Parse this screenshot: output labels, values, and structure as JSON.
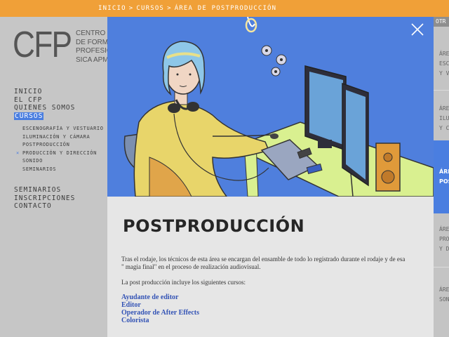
{
  "breadcrumb": {
    "items": [
      "INICIO",
      "CURSOS",
      "ÁREA DE POSTPRODUCCIÓN"
    ],
    "separator": ">"
  },
  "logo": {
    "mark": "CFP",
    "lines": [
      "CENTRO",
      "DE FORMACIÓN",
      "PROFESIONAL",
      "SICA APMA"
    ]
  },
  "menu": {
    "main": [
      "INICIO",
      "EL CFP",
      "QUIENES SOMOS",
      "CURSOS"
    ],
    "active": "CURSOS",
    "sub": [
      "ESCENOGRAFÍA Y VESTUARIO",
      "ILUMINACIÓN Y CÁMARA",
      "POSTPRODUCCIÓN",
      "PRODUCCIÓN Y DIRECCIÓN",
      "SONIDO",
      "SEMINARIOS"
    ],
    "sub_marker": "×",
    "secondary": [
      "SEMINARIOS",
      "INSCRIPCIONES",
      "CONTACTO"
    ]
  },
  "modal": {
    "title": "POSTPRODUCCIÓN",
    "description": "Tras el rodaje, los técnicos de esta área se encargan del ensamble de todo lo registrado durante el rodaje y de esa \" magia final\" en el proceso de realización audiovisual.",
    "intro": "La post producción incluye los siguientes cursos:",
    "courses": [
      "Ayudante de editor",
      "Editor",
      "Operador de After Effects",
      "Colorista"
    ]
  },
  "right_strip": {
    "header": "OTR",
    "items": [
      [
        "ÁRE",
        "ESC",
        "Y V"
      ],
      [
        "ÁRE",
        "ILU",
        "Y C"
      ],
      [
        "ÁRE",
        "POS"
      ],
      [
        "ÁRE",
        "PRO",
        "Y D"
      ],
      [
        "ÁRE",
        "SON"
      ]
    ]
  },
  "colors": {
    "accent_orange": "#f0a038",
    "accent_blue": "#4a7ee0",
    "link": "#3353b5",
    "illustration_bg": "#4f7fdd"
  },
  "icons": {
    "close": "close-icon"
  }
}
